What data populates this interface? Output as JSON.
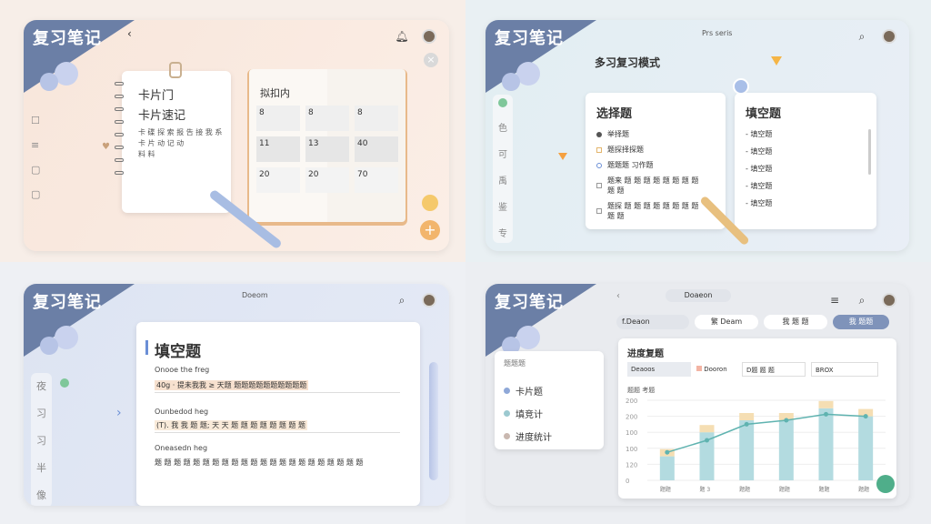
{
  "app_title": "复习笔记",
  "q1": {
    "card_line1": "卡片门",
    "card_line2": "卡片速记",
    "card_small1": "卡 碟 探 索 报 告  接 我 系",
    "card_small2": "卡 片 动 记 动",
    "card_small3": "料 料",
    "book_title": "拟扣内",
    "grid_cells": [
      "8",
      "8",
      "8",
      "11",
      "20",
      "13",
      "",
      "40",
      "",
      "20",
      "20",
      "70"
    ]
  },
  "q2": {
    "header": "Prs seris",
    "mode_title": "多习复习模式",
    "left_title": "选择题",
    "left_items": [
      "举择题",
      "题探择探题",
      "题题题 习作题",
      "题来 题 题 题 题 题 题 题 题 题 题",
      "题探 题 题 题 题 题 题 题 题 题 题"
    ],
    "right_title": "填空题",
    "right_items": [
      "填空题",
      "填空题",
      "填空题",
      "填空题",
      "填空题"
    ]
  },
  "q3": {
    "header": "Doeom",
    "title": "填空题",
    "side_items": [
      "夜",
      "习",
      "习",
      "半",
      "像"
    ],
    "sec1_label": "Onooe the freg",
    "sec1_text": "40g · 提未我我 ≥ 天题 题题题题题题题题题题",
    "sec2_label": "Ounbedod heg",
    "sec2_text": "(T). 我 我 题 题; 天 天 题 题 题  题 题 题 题 题",
    "sec3_label": "Oneasedn heg",
    "sec3_text": "题 题 题 题 题 题 题 题 题 题 题 题 题 题 题 题 题 题 题 题 题 题"
  },
  "q4": {
    "search": "Doaeon",
    "tabs": [
      "f.Deaon",
      "繁 Deam",
      "我 题 题",
      "我 题题"
    ],
    "menu_header": "题题题",
    "menu_items": [
      "卡片题",
      "填竞计",
      "进度统计"
    ],
    "chart_title": "进度复题",
    "filters": [
      "Deaoos",
      "Dooron",
      "D题 题 题",
      "BROX"
    ],
    "chart_subtitle": "题题 考题"
  },
  "colors": {
    "accent": "#6b7fa6",
    "bar": "#b3dbe0",
    "bar_top": "#f5deb3",
    "line": "#5fb3b0"
  },
  "chart_data": {
    "type": "bar",
    "categories": [
      "题题",
      "题 3",
      "题题",
      "题题",
      "题题",
      "题题"
    ],
    "series": [
      {
        "values": [
          60,
          120,
          150,
          150,
          180,
          160
        ]
      }
    ],
    "line_values": [
      70,
      100,
      140,
      150,
      165,
      160
    ],
    "ylim": [
      0,
      200
    ],
    "yticks": [
      200,
      200,
      100,
      100,
      120,
      0
    ]
  }
}
